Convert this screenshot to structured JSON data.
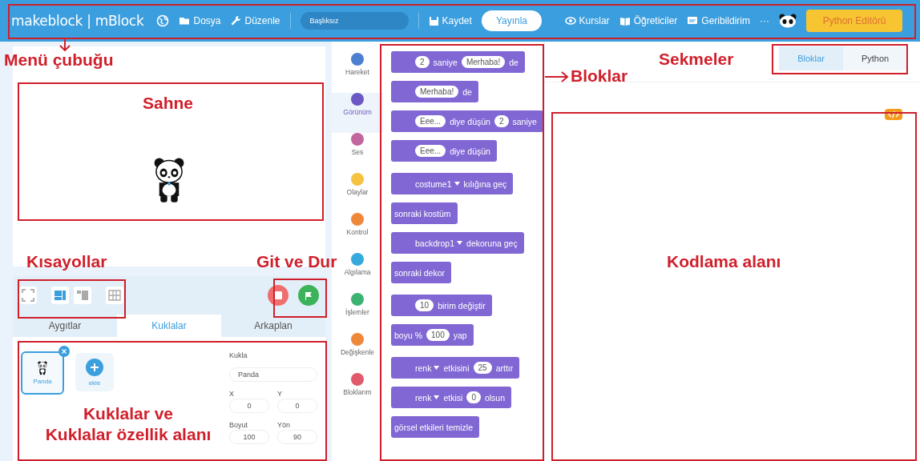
{
  "menu_bar": {
    "logo": "makeblock | mBlock",
    "menus": [
      {
        "label": "Dosya"
      },
      {
        "label": "Düzenle"
      }
    ],
    "project_name": "Başlıksız",
    "save": "Kaydet",
    "publish": "Yayınla",
    "links": [
      {
        "label": "Kurslar"
      },
      {
        "label": "Öğreticiler"
      },
      {
        "label": "Geribildirim"
      }
    ],
    "more": "···",
    "editor_button": "Python Editörü"
  },
  "stage_tabs": [
    {
      "label": "Aygıtlar",
      "selected": false
    },
    {
      "label": "Kuklalar",
      "selected": true
    },
    {
      "label": "Arkaplan",
      "selected": false
    }
  ],
  "sprites": [
    {
      "name": "Panda",
      "selected": true
    }
  ],
  "add_sprite": "ekle",
  "properties": {
    "sprite_label": "Kukla",
    "sprite_name": "Panda",
    "fields": [
      {
        "label": "X",
        "value": "0"
      },
      {
        "label": "Y",
        "value": "0"
      },
      {
        "label": "Boyut",
        "value": "100"
      },
      {
        "label": "Yön",
        "value": "90"
      }
    ]
  },
  "categories": [
    {
      "label": "Hareket",
      "color": "#4c7fd0",
      "selected": false
    },
    {
      "label": "Görünüm",
      "color": "#6b58c4",
      "selected": true
    },
    {
      "label": "Ses",
      "color": "#c2669e",
      "selected": false
    },
    {
      "label": "Olaylar",
      "color": "#f5c242",
      "selected": false
    },
    {
      "label": "Kontrol",
      "color": "#f0883a",
      "selected": false
    },
    {
      "label": "Algılama",
      "color": "#36aadc",
      "selected": false
    },
    {
      "label": "İşlemler",
      "color": "#3cb371",
      "selected": false
    },
    {
      "label": "Değişkenle",
      "color": "#f0883a",
      "selected": false
    },
    {
      "label": "Bloklarım",
      "color": "#e05a6c",
      "selected": false
    }
  ],
  "block_groups": [
    [
      {
        "parts": [
          {
            "kind": "input",
            "text": "2"
          },
          {
            "kind": "text",
            "text": "saniye"
          },
          {
            "kind": "input",
            "text": "Merhaba!"
          },
          {
            "kind": "text",
            "text": "de"
          }
        ]
      },
      {
        "parts": [
          {
            "kind": "input",
            "text": "Merhaba!"
          },
          {
            "kind": "text",
            "text": "de"
          }
        ]
      },
      {
        "parts": [
          {
            "kind": "input",
            "text": "Eee..."
          },
          {
            "kind": "text",
            "text": "diye düşün"
          },
          {
            "kind": "input",
            "text": "2"
          },
          {
            "kind": "text",
            "text": "saniye"
          }
        ]
      },
      {
        "parts": [
          {
            "kind": "input",
            "text": "Eee..."
          },
          {
            "kind": "text",
            "text": "diye düşün"
          }
        ]
      }
    ],
    [
      {
        "parts": [
          {
            "kind": "dropdown",
            "text": "costume1"
          },
          {
            "kind": "text",
            "text": "kılığına geç"
          }
        ]
      },
      {
        "parts": [
          {
            "kind": "text",
            "text": "sonraki kostüm"
          }
        ]
      },
      {
        "parts": [
          {
            "kind": "dropdown",
            "text": "backdrop1"
          },
          {
            "kind": "text",
            "text": "dekoruna geç"
          }
        ]
      },
      {
        "parts": [
          {
            "kind": "text",
            "text": "sonraki dekor"
          }
        ]
      }
    ],
    [
      {
        "parts": [
          {
            "kind": "input",
            "text": "10"
          },
          {
            "kind": "text",
            "text": "birim değiştir"
          }
        ]
      },
      {
        "parts": [
          {
            "kind": "text",
            "text": "boyu %"
          },
          {
            "kind": "input",
            "text": "100"
          },
          {
            "kind": "text",
            "text": "yap"
          }
        ]
      }
    ],
    [
      {
        "parts": [
          {
            "kind": "dropdown",
            "text": "renk"
          },
          {
            "kind": "text",
            "text": "etkisini"
          },
          {
            "kind": "input",
            "text": "25"
          },
          {
            "kind": "text",
            "text": "arttır"
          }
        ]
      },
      {
        "parts": [
          {
            "kind": "dropdown",
            "text": "renk"
          },
          {
            "kind": "text",
            "text": "etkisi"
          },
          {
            "kind": "input",
            "text": "0"
          },
          {
            "kind": "text",
            "text": "olsun"
          }
        ]
      },
      {
        "parts": [
          {
            "kind": "text",
            "text": "görsel etkileri temizle"
          }
        ]
      }
    ]
  ],
  "code_tabs": [
    {
      "label": "Bloklar",
      "selected": true
    },
    {
      "label": "Python",
      "selected": false
    }
  ],
  "annotations": [
    {
      "text": "Menü çubuğu"
    },
    {
      "text": "Sahne"
    },
    {
      "text": "Kısayollar"
    },
    {
      "text": "Git ve Dur"
    },
    {
      "text": "Kuklalar ve\nKuklalar özellik alanı"
    },
    {
      "text": "Bloklar"
    },
    {
      "text": "Sekmeler"
    },
    {
      "text": "Kodlama alanı"
    }
  ]
}
